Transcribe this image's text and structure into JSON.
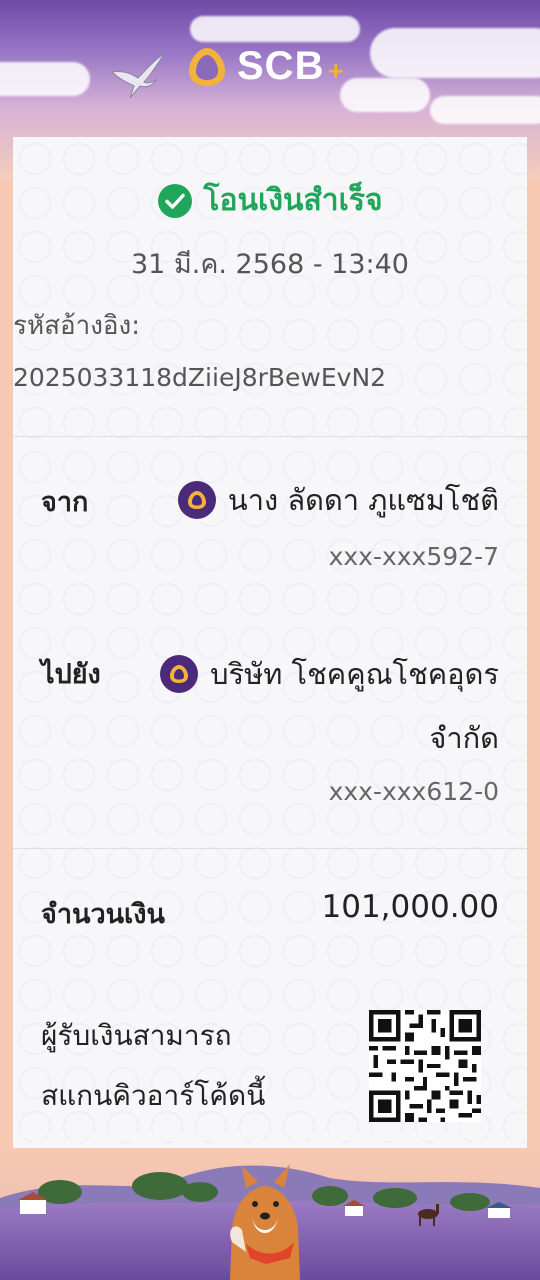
{
  "header": {
    "brand_name": "SCB",
    "brand_plus": "+",
    "brand_color": "#f3b23b"
  },
  "receipt": {
    "status_text": "โอนเงินสำเร็จ",
    "status_icon": "check-circle-icon",
    "status_color": "#1fa65a",
    "datetime": "31 มี.ค. 2568 - 13:40",
    "reference_label": "รหัสอ้างอิง:",
    "reference_value": "2025033118dZiieJ8rBewEvN2",
    "from": {
      "label": "จาก",
      "name": "นาง ลัดดา ภูแซมโชติ",
      "account": "xxx-xxx592-7",
      "bank_icon": "scb-bank-icon"
    },
    "to": {
      "label": "ไปยัง",
      "name_line1": "บริษัท โชคคูณโชคอุดร",
      "name_line2": "จำกัด",
      "account": "xxx-xxx612-0",
      "bank_icon": "scb-bank-icon"
    },
    "amount": {
      "label": "จำนวนเงิน",
      "value": "101,000.00"
    },
    "qr_note": {
      "line1": "ผู้รับเงินสามารถ",
      "line2": "สแกนคิวอาร์โค้ดนี้"
    }
  }
}
